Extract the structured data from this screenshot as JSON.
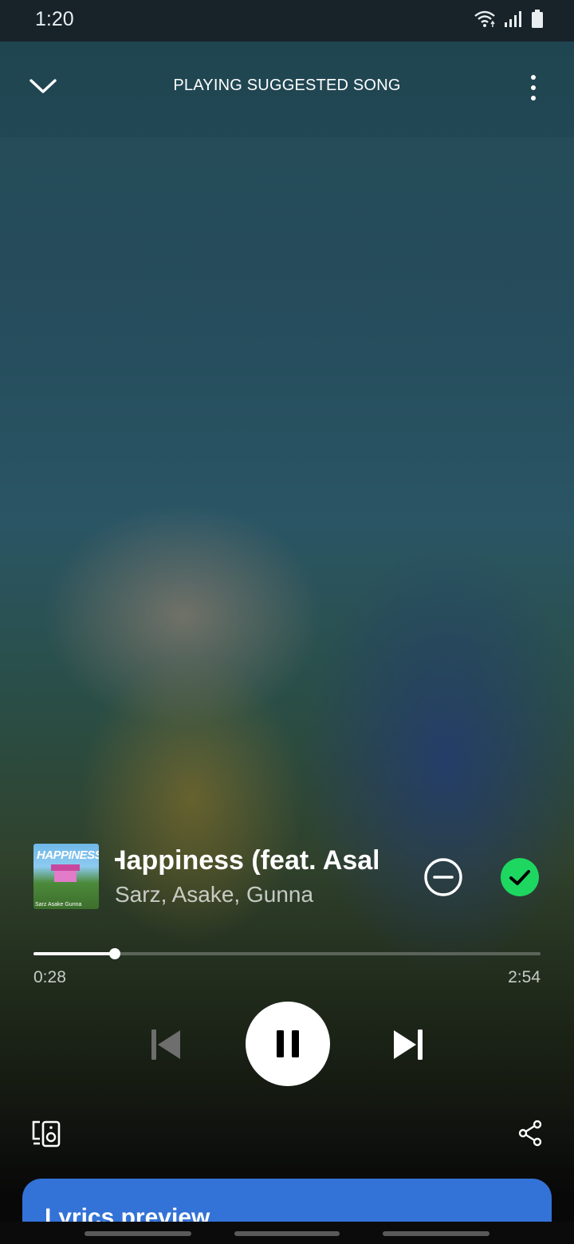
{
  "status_bar": {
    "time": "1:20",
    "icons": [
      "wifi-icon",
      "signal-icon",
      "battery-icon"
    ]
  },
  "header": {
    "title": "PLAYING SUGGESTED SONG",
    "left_icon": "chevron-down-icon",
    "right_icon": "more-vertical-icon"
  },
  "track": {
    "album_art_text": "HAPPINESS",
    "album_art_credits": "Sarz   Asake   Gunna",
    "title": "Happiness (feat. Asake)",
    "artists": "Sarz, Asake, Gunna",
    "liked": true
  },
  "playback": {
    "elapsed": "0:28",
    "duration": "2:54",
    "progress_fraction": 0.161,
    "state": "playing"
  },
  "lyrics": {
    "title": "Lyrics preview"
  },
  "colors": {
    "accent_green": "#1ed760",
    "lyrics_card": "#3372d6",
    "status_bar_bg": "#172329"
  }
}
